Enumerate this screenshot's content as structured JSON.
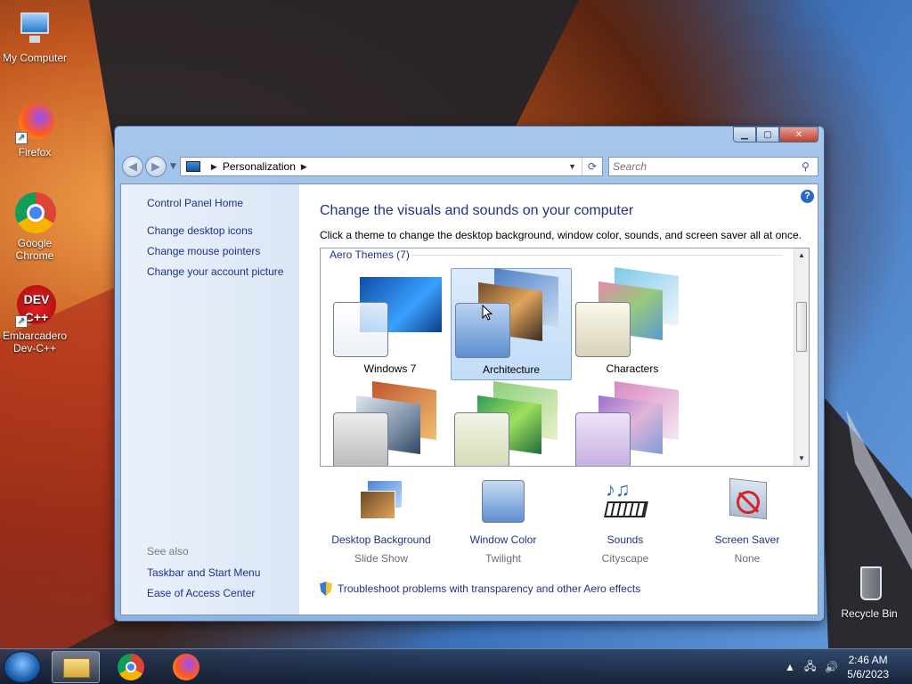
{
  "desktop": {
    "icons": [
      {
        "label": "My Computer"
      },
      {
        "label": "Firefox"
      },
      {
        "label": "Google Chrome"
      },
      {
        "label": "Embarcadero Dev-C++"
      },
      {
        "label": "Recycle Bin"
      }
    ]
  },
  "window": {
    "address": {
      "segment": "Personalization"
    },
    "search": {
      "placeholder": "Search"
    },
    "left_nav": {
      "links": [
        "Control Panel Home",
        "Change desktop icons",
        "Change mouse pointers",
        "Change your account picture"
      ],
      "see_also_title": "See also",
      "see_also": [
        "Taskbar and Start Menu",
        "Ease of Access Center"
      ]
    },
    "main": {
      "title": "Change the visuals and sounds on your computer",
      "description": "Click a theme to change the desktop background, window color, sounds, and screen saver all at once.",
      "group_title": "Aero Themes (7)",
      "themes": [
        {
          "name": "Windows 7",
          "selected": false
        },
        {
          "name": "Architecture",
          "selected": true
        },
        {
          "name": "Characters",
          "selected": false
        },
        {
          "name": "",
          "selected": false
        },
        {
          "name": "",
          "selected": false
        },
        {
          "name": "",
          "selected": false
        }
      ],
      "options": [
        {
          "name": "Desktop Background",
          "value": "Slide Show"
        },
        {
          "name": "Window Color",
          "value": "Twilight"
        },
        {
          "name": "Sounds",
          "value": "Cityscape"
        },
        {
          "name": "Screen Saver",
          "value": "None"
        }
      ],
      "troubleshoot": "Troubleshoot problems with transparency and other Aero effects"
    }
  },
  "taskbar": {
    "time": "2:46 AM",
    "date": "5/6/2023"
  },
  "colors": {
    "link": "#1e3287",
    "accent": "#2966c5"
  }
}
